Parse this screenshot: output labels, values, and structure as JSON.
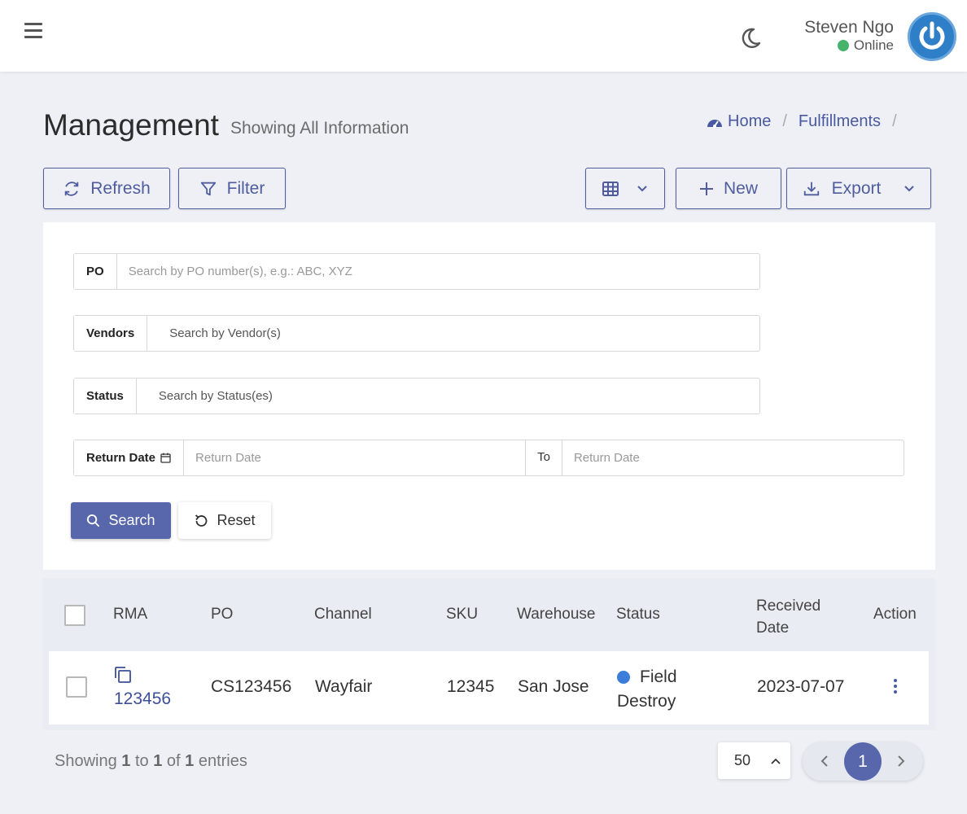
{
  "header": {
    "user_name": "Steven Ngo",
    "user_status": "Online",
    "status_color": "#45b36b",
    "avatar_color": "#2f7fc8"
  },
  "page": {
    "title": "Management",
    "subtitle": "Showing All Information"
  },
  "breadcrumb": {
    "home": "Home",
    "fulfillments": "Fulfillments",
    "separator": "/"
  },
  "toolbar": {
    "refresh": "Refresh",
    "filter": "Filter",
    "new": "New",
    "export": "Export"
  },
  "filters": {
    "po": {
      "label": "PO",
      "placeholder": "Search by PO number(s), e.g.: ABC, XYZ"
    },
    "vendors": {
      "label": "Vendors",
      "placeholder": "Search by Vendor(s)"
    },
    "status": {
      "label": "Status",
      "placeholder": "Search by Status(es)"
    },
    "return_date": {
      "label": "Return Date",
      "from_placeholder": "Return Date",
      "to_label": "To",
      "to_placeholder": "Return Date"
    },
    "search_button": "Search",
    "reset_button": "Reset"
  },
  "table": {
    "columns": [
      "RMA",
      "PO",
      "Channel",
      "SKU",
      "Warehouse",
      "Status",
      "Received Date",
      "Action"
    ],
    "received_date_line1": "Received",
    "received_date_line2": "Date",
    "rows": [
      {
        "rma": "123456",
        "po": "CS123456",
        "channel": "Wayfair",
        "sku": "12345",
        "warehouse": "San Jose",
        "status_line1": "Field",
        "status_line2": "Destroy",
        "status_color": "#3b7dd8",
        "received_date": "2023-07-07"
      }
    ]
  },
  "footer": {
    "showing_prefix": "Showing",
    "from": "1",
    "to_word": "to",
    "to": "1",
    "of_word": "of",
    "total": "1",
    "suffix": "entries",
    "page_size": "50",
    "current_page": "1"
  },
  "accent_color": "#5866ab"
}
